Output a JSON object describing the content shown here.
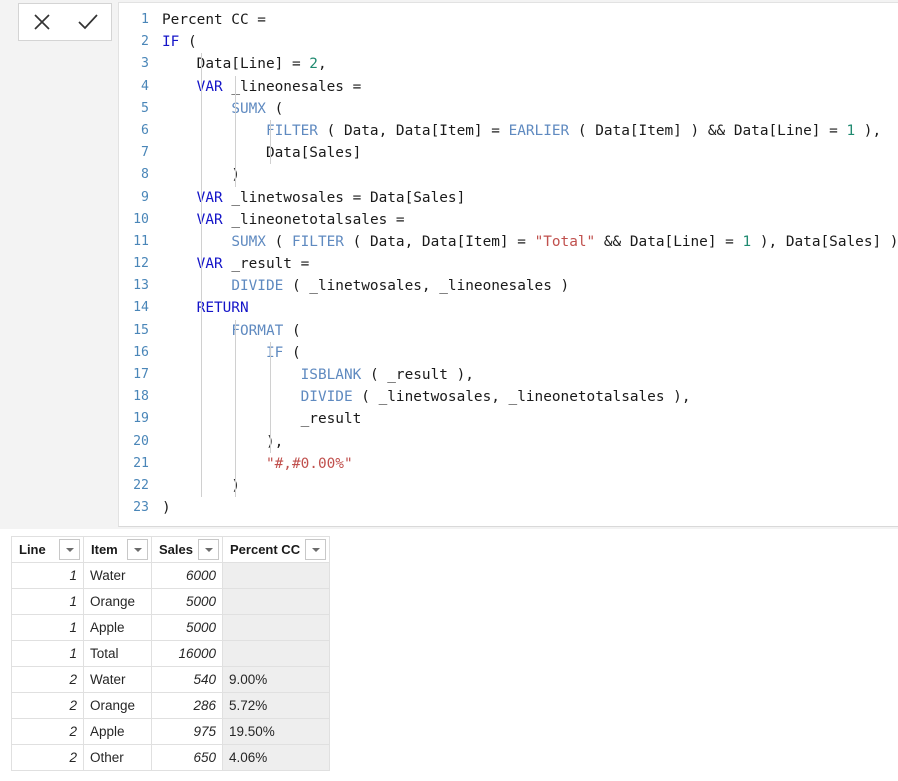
{
  "toolbar": {
    "cancel_label": "✕",
    "cancel_icon": "close-icon",
    "accept_label": "✓",
    "accept_icon": "checkmark-icon"
  },
  "editor": {
    "measure_name": "Percent CC",
    "language": "DAX",
    "total_lines": 23,
    "colors": {
      "keyword": "#1414c8",
      "function": "#5f8ac0",
      "number": "#1f8a70",
      "string": "#c0504d",
      "plain": "#1a1a1a",
      "line_number": "#4a86b8"
    },
    "lines": [
      {
        "n": "1",
        "tokens": [
          {
            "t": "Percent CC =",
            "c": "plain"
          }
        ]
      },
      {
        "n": "2",
        "tokens": [
          {
            "t": "IF",
            "c": "kw"
          },
          {
            "t": " (",
            "c": "plain"
          }
        ]
      },
      {
        "n": "3",
        "tokens": [
          {
            "t": "    Data[Line] = ",
            "c": "plain"
          },
          {
            "t": "2",
            "c": "num"
          },
          {
            "t": ",",
            "c": "plain"
          }
        ]
      },
      {
        "n": "4",
        "tokens": [
          {
            "t": "    ",
            "c": "plain"
          },
          {
            "t": "VAR",
            "c": "kw"
          },
          {
            "t": " _lineonesales =",
            "c": "plain"
          }
        ]
      },
      {
        "n": "5",
        "tokens": [
          {
            "t": "        ",
            "c": "plain"
          },
          {
            "t": "SUMX",
            "c": "fn"
          },
          {
            "t": " (",
            "c": "plain"
          }
        ]
      },
      {
        "n": "6",
        "tokens": [
          {
            "t": "            ",
            "c": "plain"
          },
          {
            "t": "FILTER",
            "c": "fn"
          },
          {
            "t": " ( Data, Data[Item] = ",
            "c": "plain"
          },
          {
            "t": "EARLIER",
            "c": "fn"
          },
          {
            "t": " ( Data[Item] ) && Data[Line] = ",
            "c": "plain"
          },
          {
            "t": "1",
            "c": "num"
          },
          {
            "t": " ),",
            "c": "plain"
          }
        ]
      },
      {
        "n": "7",
        "tokens": [
          {
            "t": "            Data[Sales]",
            "c": "plain"
          }
        ]
      },
      {
        "n": "8",
        "tokens": [
          {
            "t": "        )",
            "c": "plain"
          }
        ]
      },
      {
        "n": "9",
        "tokens": [
          {
            "t": "    ",
            "c": "plain"
          },
          {
            "t": "VAR",
            "c": "kw"
          },
          {
            "t": " _linetwosales = Data[Sales]",
            "c": "plain"
          }
        ]
      },
      {
        "n": "10",
        "tokens": [
          {
            "t": "    ",
            "c": "plain"
          },
          {
            "t": "VAR",
            "c": "kw"
          },
          {
            "t": " _lineonetotalsales =",
            "c": "plain"
          }
        ]
      },
      {
        "n": "11",
        "tokens": [
          {
            "t": "        ",
            "c": "plain"
          },
          {
            "t": "SUMX",
            "c": "fn"
          },
          {
            "t": " ( ",
            "c": "plain"
          },
          {
            "t": "FILTER",
            "c": "fn"
          },
          {
            "t": " ( Data, Data[Item] = ",
            "c": "plain"
          },
          {
            "t": "\"Total\"",
            "c": "str"
          },
          {
            "t": " && Data[Line] = ",
            "c": "plain"
          },
          {
            "t": "1",
            "c": "num"
          },
          {
            "t": " ), Data[Sales] )",
            "c": "plain"
          }
        ]
      },
      {
        "n": "12",
        "tokens": [
          {
            "t": "    ",
            "c": "plain"
          },
          {
            "t": "VAR",
            "c": "kw"
          },
          {
            "t": " _result =",
            "c": "plain"
          }
        ]
      },
      {
        "n": "13",
        "tokens": [
          {
            "t": "        ",
            "c": "plain"
          },
          {
            "t": "DIVIDE",
            "c": "fn"
          },
          {
            "t": " ( _linetwosales, _lineonesales )",
            "c": "plain"
          }
        ]
      },
      {
        "n": "14",
        "tokens": [
          {
            "t": "    ",
            "c": "plain"
          },
          {
            "t": "RETURN",
            "c": "kw"
          }
        ]
      },
      {
        "n": "15",
        "tokens": [
          {
            "t": "        ",
            "c": "plain"
          },
          {
            "t": "FORMAT",
            "c": "fn"
          },
          {
            "t": " (",
            "c": "plain"
          }
        ]
      },
      {
        "n": "16",
        "tokens": [
          {
            "t": "            ",
            "c": "plain"
          },
          {
            "t": "IF",
            "c": "fn"
          },
          {
            "t": " (",
            "c": "plain"
          }
        ]
      },
      {
        "n": "17",
        "tokens": [
          {
            "t": "                ",
            "c": "plain"
          },
          {
            "t": "ISBLANK",
            "c": "fn"
          },
          {
            "t": " ( _result ),",
            "c": "plain"
          }
        ]
      },
      {
        "n": "18",
        "tokens": [
          {
            "t": "                ",
            "c": "plain"
          },
          {
            "t": "DIVIDE",
            "c": "fn"
          },
          {
            "t": " ( _linetwosales, _lineonetotalsales ),",
            "c": "plain"
          }
        ]
      },
      {
        "n": "19",
        "tokens": [
          {
            "t": "                _result",
            "c": "plain"
          }
        ]
      },
      {
        "n": "20",
        "tokens": [
          {
            "t": "            ),",
            "c": "plain"
          }
        ]
      },
      {
        "n": "21",
        "tokens": [
          {
            "t": "            ",
            "c": "plain"
          },
          {
            "t": "\"#,#0.00%\"",
            "c": "str"
          }
        ]
      },
      {
        "n": "22",
        "tokens": [
          {
            "t": "        )",
            "c": "plain"
          }
        ]
      },
      {
        "n": "23",
        "tokens": [
          {
            "t": ")",
            "c": "plain"
          }
        ]
      }
    ]
  },
  "table": {
    "highlight_color": "#e9c10e",
    "columns": [
      {
        "label": "Line",
        "highlighted": false,
        "filter_icon": "chevron-down-icon"
      },
      {
        "label": "Item",
        "highlighted": false,
        "filter_icon": "chevron-down-icon"
      },
      {
        "label": "Sales",
        "highlighted": false,
        "filter_icon": "chevron-down-icon"
      },
      {
        "label": "Percent CC",
        "highlighted": true,
        "filter_icon": "chevron-down-icon"
      }
    ],
    "rows": [
      {
        "line": "1",
        "item": "Water",
        "sales": "6000",
        "percent_cc": ""
      },
      {
        "line": "1",
        "item": "Orange",
        "sales": "5000",
        "percent_cc": ""
      },
      {
        "line": "1",
        "item": "Apple",
        "sales": "5000",
        "percent_cc": ""
      },
      {
        "line": "1",
        "item": "Total",
        "sales": "16000",
        "percent_cc": ""
      },
      {
        "line": "2",
        "item": "Water",
        "sales": "540",
        "percent_cc": "9.00%"
      },
      {
        "line": "2",
        "item": "Orange",
        "sales": "286",
        "percent_cc": "5.72%"
      },
      {
        "line": "2",
        "item": "Apple",
        "sales": "975",
        "percent_cc": "19.50%"
      },
      {
        "line": "2",
        "item": "Other",
        "sales": "650",
        "percent_cc": "4.06%"
      }
    ]
  }
}
